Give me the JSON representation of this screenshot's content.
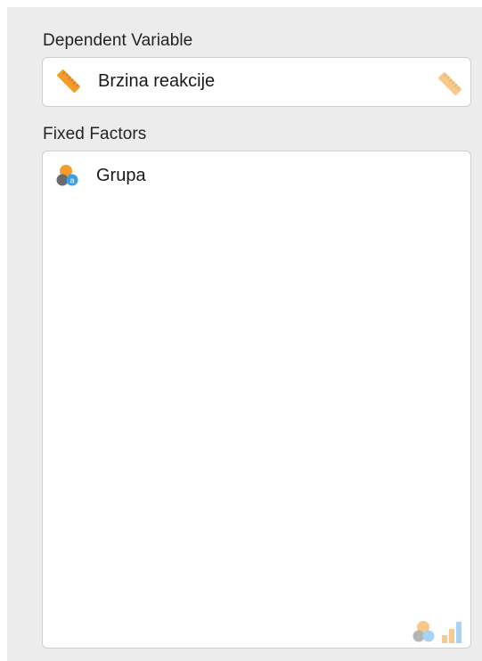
{
  "dependent_variable": {
    "heading": "Dependent Variable",
    "item": {
      "label": "Brzina reakcije",
      "icon": "ruler-icon"
    },
    "accepted_type_icon": "ruler-icon"
  },
  "fixed_factors": {
    "heading": "Fixed Factors",
    "items": [
      {
        "label": "Grupa",
        "icon": "nominal-text-icon"
      }
    ],
    "accepted_type_icons": [
      "nominal-icon",
      "ordinal-icon"
    ]
  },
  "colors": {
    "ruler_orange": "#f39c2c",
    "ruler_faded": "#f7c98a",
    "nominal_orange": "#f39c2c",
    "nominal_gray": "#6b6b6b",
    "nominal_blue": "#3aa0e6"
  }
}
